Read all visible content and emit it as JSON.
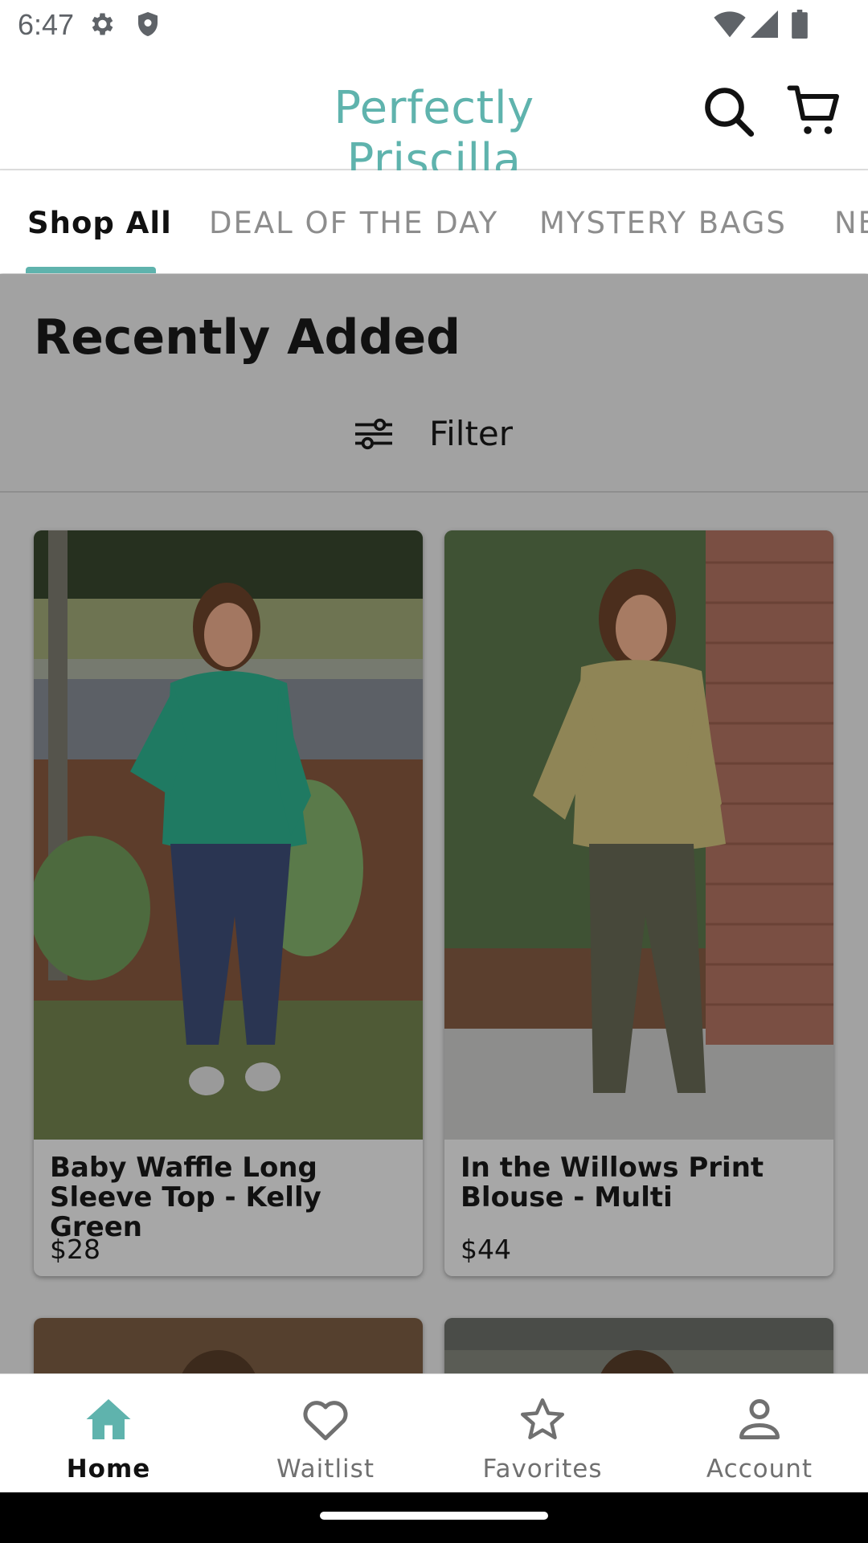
{
  "status_bar": {
    "time": "6:47",
    "icons_left": [
      "gear-icon",
      "shield-icon"
    ],
    "icons_right": [
      "wifi-icon",
      "signal-icon",
      "battery-icon"
    ]
  },
  "header": {
    "title": "Perfectly Priscilla",
    "title_color": "#5fb3ad",
    "search_icon": "search-icon",
    "cart_icon": "cart-icon"
  },
  "tabs": [
    {
      "label": "Shop All",
      "active": true
    },
    {
      "label": "DEAL OF THE DAY",
      "active": false
    },
    {
      "label": "MYSTERY BAGS",
      "active": false
    },
    {
      "label": "NE",
      "active": false
    }
  ],
  "section": {
    "title": "Recently Added",
    "filter_label": "Filter",
    "filter_icon": "sliders-icon"
  },
  "products": [
    {
      "title": "Baby Waffle Long Sleeve Top - Kelly Green",
      "price": "$28",
      "image": "product-photo-green-top"
    },
    {
      "title": "In the Willows Print Blouse - Multi",
      "price": "$44",
      "image": "product-photo-print-blouse"
    }
  ],
  "bottom_nav": [
    {
      "label": "Home",
      "icon": "home-icon",
      "active": true
    },
    {
      "label": "Waitlist",
      "icon": "heart-icon",
      "active": false
    },
    {
      "label": "Favorites",
      "icon": "star-icon",
      "active": false
    },
    {
      "label": "Account",
      "icon": "person-icon",
      "active": false
    }
  ],
  "colors": {
    "accent": "#5fb3ad",
    "overlay": "#a2a2a2"
  }
}
